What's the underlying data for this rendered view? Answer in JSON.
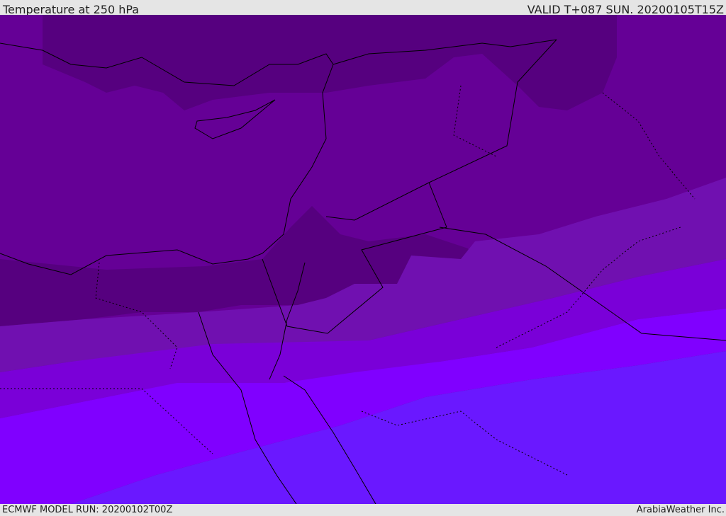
{
  "header": {
    "title": "Temperature at 250 hPa",
    "valid": "VALID T+087 SUN. 20200105T15Z"
  },
  "footer": {
    "model_run": "ECMWF MODEL RUN: 20200102T00Z",
    "credit": "ArabiaWeather Inc."
  },
  "map": {
    "band_colors": [
      "#56007f",
      "#650096",
      "#7010b0",
      "#7a00d8",
      "#8000ff",
      "#6a18ff"
    ]
  }
}
